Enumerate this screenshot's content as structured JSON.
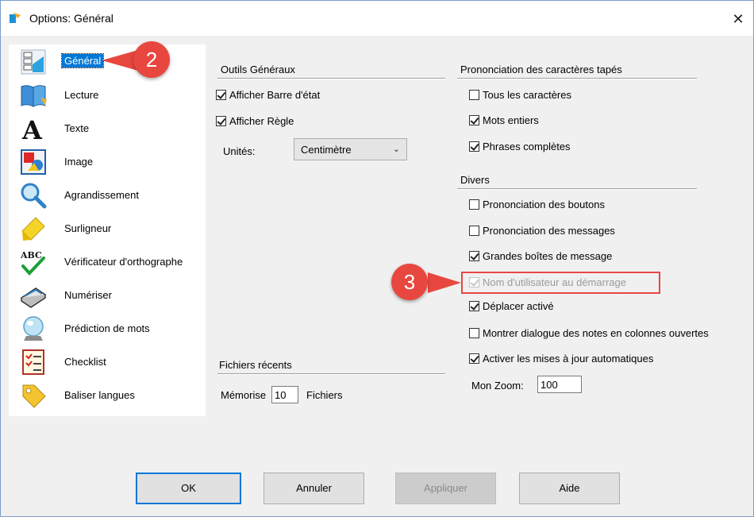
{
  "window": {
    "title": "Options: Général",
    "close_glyph": "✕"
  },
  "sidebar": {
    "items": [
      {
        "label": "Général",
        "icon": "general-options-icon",
        "selected": true
      },
      {
        "label": "Lecture",
        "icon": "book-icon"
      },
      {
        "label": "Texte",
        "icon": "text-A-icon"
      },
      {
        "label": "Image",
        "icon": "image-icon"
      },
      {
        "label": "Agrandissement",
        "icon": "magnifier-icon"
      },
      {
        "label": "Surligneur",
        "icon": "highlighter-icon"
      },
      {
        "label": "Vérificateur d'orthographe",
        "icon": "spellcheck-icon"
      },
      {
        "label": "Numériser",
        "icon": "scanner-icon"
      },
      {
        "label": "Prédiction de mots",
        "icon": "crystal-ball-icon"
      },
      {
        "label": "Checklist",
        "icon": "checklist-icon"
      },
      {
        "label": "Baliser langues",
        "icon": "tag-icon"
      }
    ]
  },
  "outils": {
    "title": "Outils Généraux",
    "show_status_bar": {
      "label": "Afficher Barre d'état",
      "checked": true
    },
    "show_ruler": {
      "label": "Afficher Règle",
      "checked": true
    },
    "units_label": "Unités:",
    "units_value": "Centimètre"
  },
  "recent": {
    "title": "Fichiers récents",
    "memorize_label": "Mémorise",
    "count": "10",
    "files_label": "Fichiers"
  },
  "pronunciation": {
    "title": "Prononciation des caractères tapés",
    "all_chars": {
      "label": "Tous les caractères",
      "checked": false
    },
    "whole_words": {
      "label": "Mots entiers",
      "checked": true
    },
    "full_sentences": {
      "label": "Phrases complètes",
      "checked": true
    }
  },
  "divers": {
    "title": "Divers",
    "items": [
      {
        "label": "Prononciation des boutons",
        "checked": false,
        "disabled": false
      },
      {
        "label": "Prononciation des messages",
        "checked": false,
        "disabled": false
      },
      {
        "label": "Grandes boîtes de message",
        "checked": true,
        "disabled": false
      },
      {
        "label": "Nom d'utilisateur au démarrage",
        "checked": true,
        "disabled": true
      },
      {
        "label": "Déplacer activé",
        "checked": true,
        "disabled": false
      },
      {
        "label": "Montrer dialogue des notes en colonnes ouvertes",
        "checked": false,
        "disabled": false
      },
      {
        "label": "Activer les mises à jour automatiques",
        "checked": true,
        "disabled": false
      }
    ],
    "zoom_label": "Mon Zoom:",
    "zoom_value": "100"
  },
  "buttons": {
    "ok": "OK",
    "cancel": "Annuler",
    "apply": "Appliquer",
    "help": "Aide"
  },
  "callouts": {
    "first": "2",
    "second": "3",
    "color": "#e8473f"
  }
}
